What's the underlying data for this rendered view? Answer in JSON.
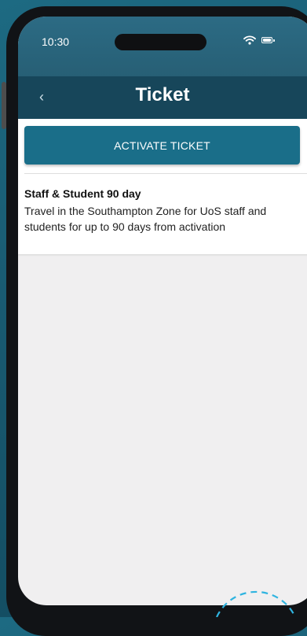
{
  "status_bar": {
    "time": "10:30"
  },
  "nav": {
    "title": "Ticket",
    "back_icon": "‹"
  },
  "actions": {
    "activate_label": "ACTIVATE TICKET"
  },
  "ticket": {
    "name": "Staff & Student 90 day",
    "description": "Travel in the Southampton Zone for UoS staff and students for up to 90 days from activation"
  },
  "colors": {
    "nav_bar": "#17465a",
    "status_bar": "#2c6b84",
    "button": "#1a6e89",
    "background": "#195b72"
  }
}
